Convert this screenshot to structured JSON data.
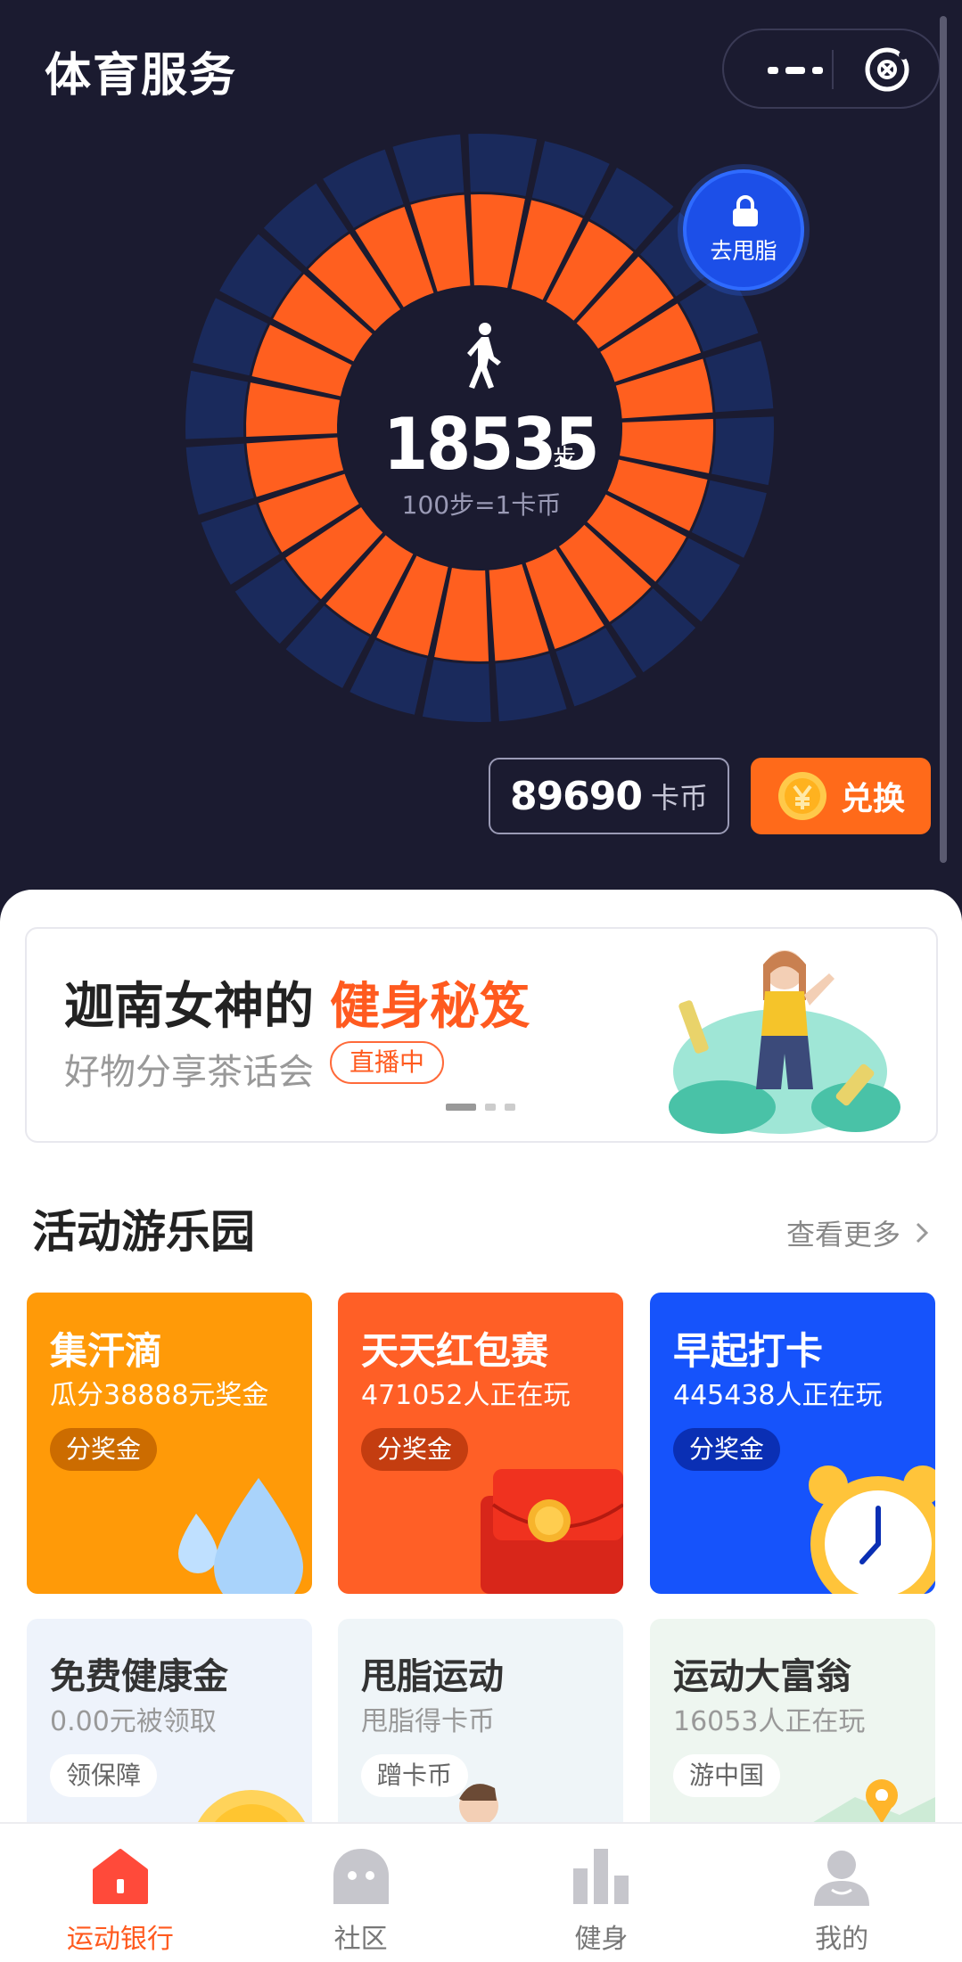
{
  "app": {
    "title": "体育服务"
  },
  "dial": {
    "steps": "18535",
    "steps_unit": "步",
    "rate": "100步=1卡币",
    "fat_button": "去甩脂"
  },
  "wallet": {
    "coins": "89690",
    "coins_unit": "卡币",
    "exchange_label": "兑换"
  },
  "banner": {
    "title": "迦南女神的",
    "title_highlight": "健身秘笈",
    "subtitle": "好物分享茶话会",
    "badge": "直播中"
  },
  "section": {
    "title": "活动游乐园",
    "more": "查看更多"
  },
  "cards": [
    {
      "title": "集汗滴",
      "subtitle": "瓜分38888元奖金",
      "button": "分奖金"
    },
    {
      "title": "天天红包赛",
      "subtitle": "471052人正在玩",
      "button": "分奖金"
    },
    {
      "title": "早起打卡",
      "subtitle": "445438人正在玩",
      "button": "分奖金"
    },
    {
      "title": "免费健康金",
      "subtitle": "0.00元被领取",
      "button": "领保障"
    },
    {
      "title": "甩脂运动",
      "subtitle": "甩脂得卡币",
      "button": "蹭卡币"
    },
    {
      "title": "运动大富翁",
      "subtitle": "16053人正在玩",
      "button": "游中国"
    }
  ],
  "tabs": [
    {
      "label": "运动银行",
      "icon": "home-icon",
      "active": true
    },
    {
      "label": "社区",
      "icon": "community-icon",
      "active": false
    },
    {
      "label": "健身",
      "icon": "chart-icon",
      "active": false
    },
    {
      "label": "我的",
      "icon": "profile-icon",
      "active": false
    }
  ],
  "colors": {
    "header_bg": "#1b1b30",
    "accent": "#ff5a1f",
    "ring_orange": "#ff5f1f",
    "ring_blue": "#1a2a5c"
  }
}
